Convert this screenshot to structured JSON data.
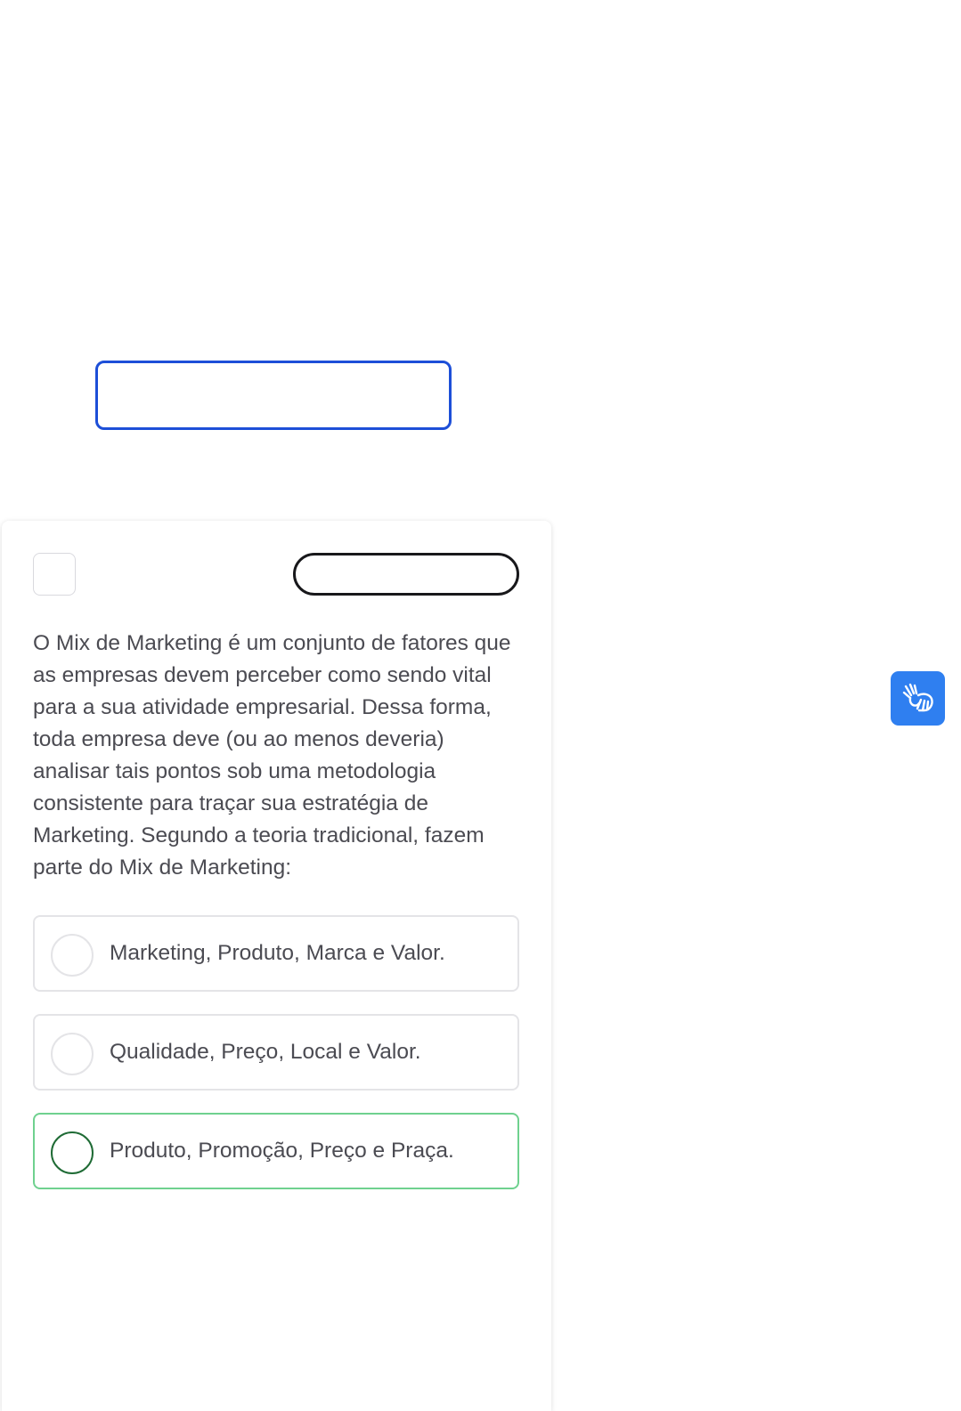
{
  "question": {
    "text": "O Mix de Marketing é um conjunto de fatores que as empresas devem perceber como sendo vital para a sua atividade empresarial. Dessa forma, toda empresa deve (ou ao menos deveria) analisar tais pontos sob uma metodologia consistente para traçar sua estratégia de Marketing. Segundo a teoria tradicional, fazem parte do Mix de Marketing:"
  },
  "options": [
    {
      "label": "Marketing, Produto, Marca e Valor.",
      "selected": false
    },
    {
      "label": "Qualidade, Preço, Local e Valor.",
      "selected": false
    },
    {
      "label": "Produto, Promoção, Preço e Praça.",
      "selected": true
    }
  ],
  "accessibility": {
    "icon": "sign-language-hands-icon",
    "color": "#2f7ff0"
  },
  "colors": {
    "focus_outline": "#1d4fd8",
    "selected_border": "#6fd18f",
    "selected_radio": "#1f6b35"
  }
}
